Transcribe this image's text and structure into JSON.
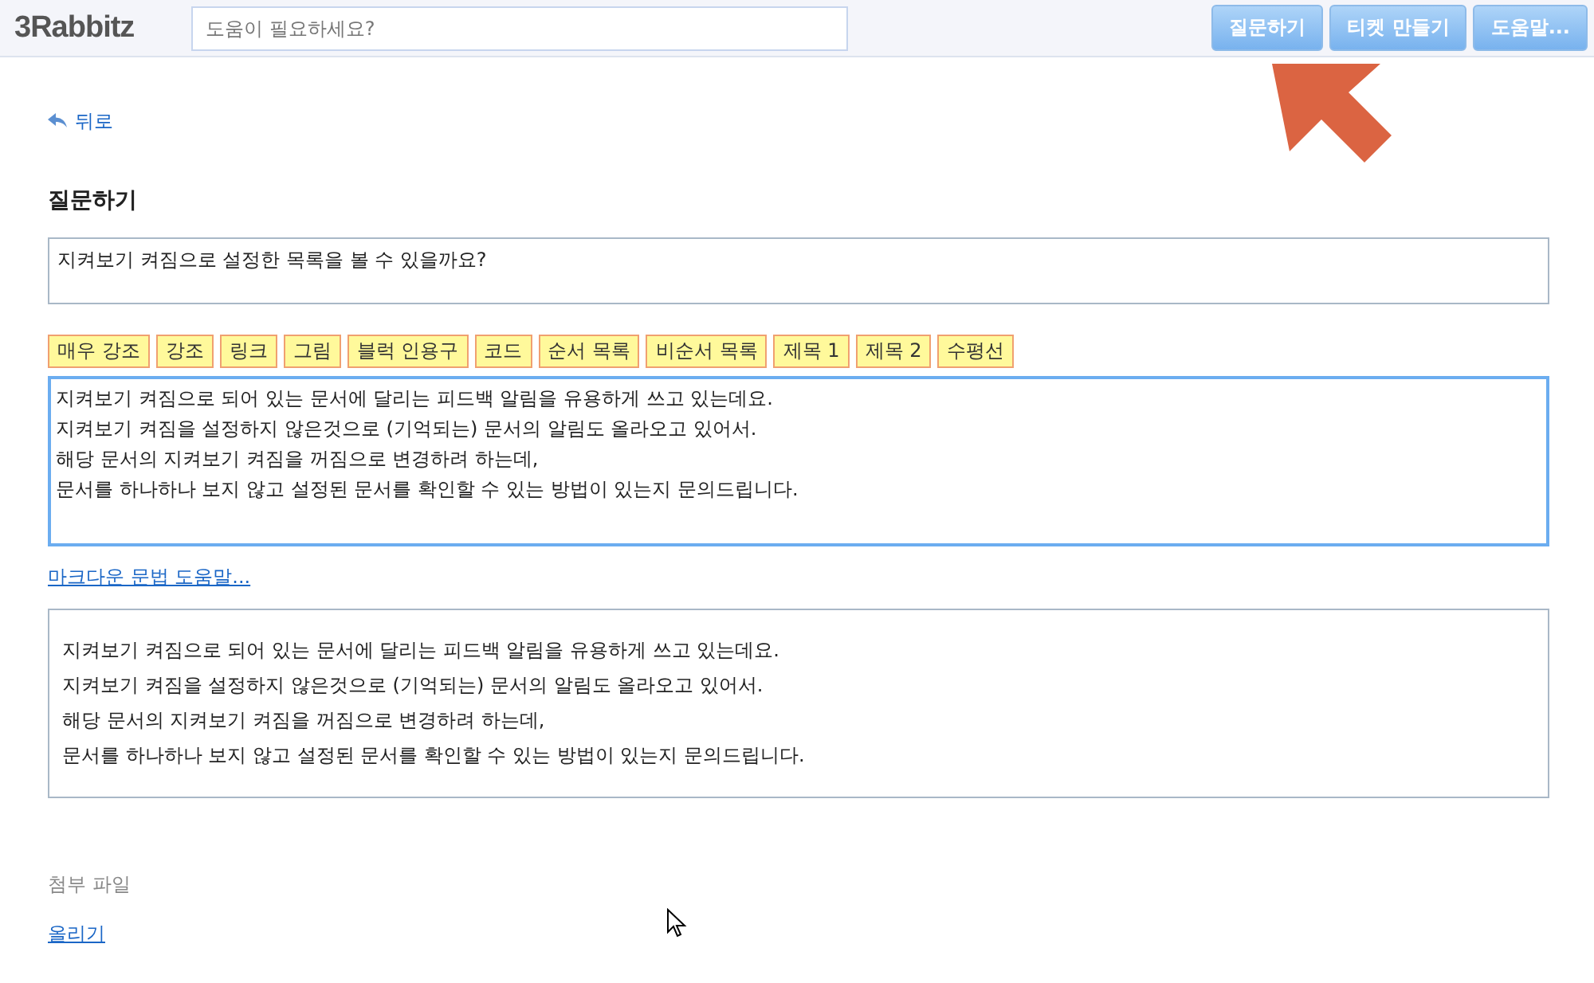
{
  "header": {
    "logo": "3Rabbitz",
    "search": {
      "placeholder": "도움이 필요하세요?"
    },
    "buttons": [
      {
        "label": "질문하기"
      },
      {
        "label": "티켓 만들기"
      },
      {
        "label": "도움말..."
      }
    ]
  },
  "back_link": "뒤로",
  "page_title": "질문하기",
  "question_field": {
    "value": "지켜보기 켜짐으로 설정한 목록을 볼 수 있을까요?"
  },
  "toolbar": [
    "매우 강조",
    "강조",
    "링크",
    "그림",
    "블럭 인용구",
    "코드",
    "순서 목록",
    "비순서 목록",
    "제목 1",
    "제목 2",
    "수평선"
  ],
  "editor": {
    "lines": [
      "지켜보기 켜짐으로 되어 있는 문서에 달리는 피드백 알림을 유용하게 쓰고 있는데요.",
      "지켜보기 켜짐을 설정하지 않은것으로 (기억되는) 문서의 알림도 올라오고 있어서.",
      "해당 문서의 지켜보기 켜짐을 꺼짐으로 변경하려 하는데,",
      "문서를 하나하나 보지 않고 설정된 문서를 확인할 수 있는 방법이 있는지 문의드립니다."
    ]
  },
  "markdown_help_link": "마크다운 문법 도움말...",
  "preview": {
    "lines": [
      "지켜보기 켜짐으로 되어 있는 문서에 달리는 피드백 알림을 유용하게 쓰고 있는데요.",
      "지켜보기 켜짐을 설정하지 않은것으로 (기억되는) 문서의 알림도 올라오고 있어서.",
      "해당 문서의 지켜보기 켜짐을 꺼짐으로 변경하려 하는데,",
      "문서를 하나하나 보지 않고 설정된 문서를 확인할 수 있는 방법이 있는지 문의드립니다."
    ]
  },
  "attachments": {
    "label": "첨부 파일",
    "upload_link": "올리기"
  }
}
